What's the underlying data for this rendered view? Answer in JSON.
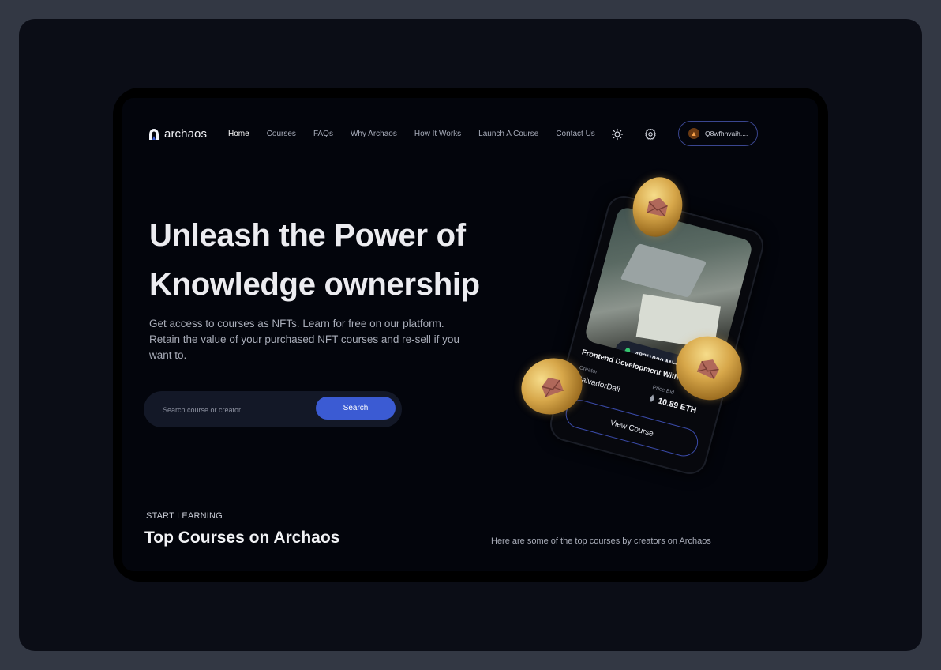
{
  "brand": {
    "name": "archaos"
  },
  "nav": {
    "items": [
      {
        "label": "Home",
        "active": true
      },
      {
        "label": "Courses"
      },
      {
        "label": "FAQs"
      },
      {
        "label": "Why Archaos"
      },
      {
        "label": "How It Works"
      },
      {
        "label": "Launch A Course"
      },
      {
        "label": "Contact Us"
      }
    ],
    "wallet": "Q8wfhhvaih...."
  },
  "hero": {
    "title_line1": "Unleash the Power of",
    "title_line2": "Knowledge ownership",
    "subtitle": "Get access to courses as NFTs. Learn for free on our platform. Retain the value of your purchased NFT courses and re-sell if you want to.",
    "search": {
      "placeholder": "Search course or creator",
      "button": "Search"
    }
  },
  "nft_card": {
    "minted": "483/1000 Minted",
    "title": "Frontend Development With React",
    "creator_label": "Creator",
    "creator_name": "SalvadorDali",
    "price_label": "Price Bid",
    "price": "10.89 ETH",
    "button": "View Course"
  },
  "section": {
    "kicker": "START LEARNING",
    "title": "Top Courses on Archaos",
    "description": "Here are some of the  top courses by creators on Archaos"
  },
  "colors": {
    "accent": "#3b5bd3",
    "background": "#03050c",
    "coin_gold": "#d7a74a",
    "minted_green": "#34c56f"
  },
  "icons": [
    "archaos-logo-icon",
    "sun-icon",
    "gear-icon",
    "metamask-fox-icon",
    "drop-icon",
    "ethereum-icon",
    "envelope-icon"
  ]
}
